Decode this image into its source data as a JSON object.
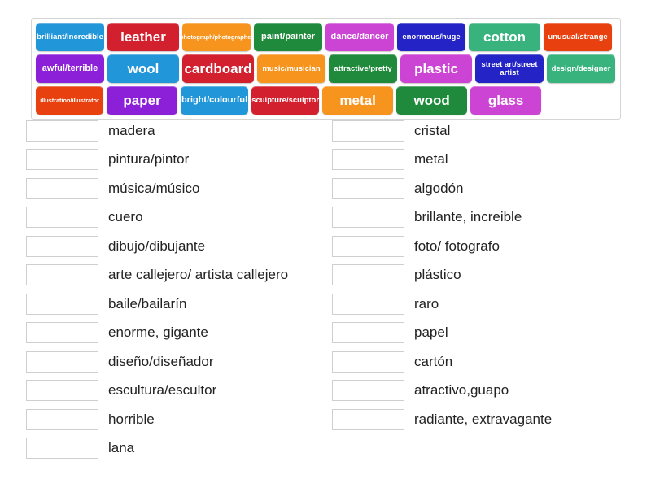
{
  "activity": {
    "type": "match-up",
    "tile_bank": {
      "rows": [
        [
          {
            "label": "brilliant/incredible",
            "color": "#2196d9",
            "size": "s"
          },
          {
            "label": "leather",
            "color": "#d3202f",
            "size": "xl"
          },
          {
            "label": "photograph/photographer",
            "color": "#f7941e",
            "size": "xs"
          },
          {
            "label": "paint/painter",
            "color": "#1f8a3b",
            "size": "m"
          },
          {
            "label": "dance/dancer",
            "color": "#cc44d4",
            "size": "m"
          },
          {
            "label": "enormous/huge",
            "color": "#2323c6",
            "size": "s"
          },
          {
            "label": "cotton",
            "color": "#39b37e",
            "size": "xl"
          },
          {
            "label": "unusual/strange",
            "color": "#e8400e",
            "size": "s"
          }
        ],
        [
          {
            "label": "awful/terrible",
            "color": "#8c1fd8",
            "size": "m"
          },
          {
            "label": "wool",
            "color": "#2196d9",
            "size": "xl"
          },
          {
            "label": "cardboard",
            "color": "#d3202f",
            "size": "xl"
          },
          {
            "label": "music/musician",
            "color": "#f7941e",
            "size": "s"
          },
          {
            "label": "attractive/pretty",
            "color": "#1f8a3b",
            "size": "s"
          },
          {
            "label": "plastic",
            "color": "#cc44d4",
            "size": "xl"
          },
          {
            "label": "street art/street artist",
            "color": "#2323c6",
            "size": "s"
          },
          {
            "label": "design/designer",
            "color": "#39b37e",
            "size": "s"
          }
        ],
        [
          {
            "label": "illustration/illustrator",
            "color": "#e8400e",
            "size": "xs"
          },
          {
            "label": "paper",
            "color": "#8c1fd8",
            "size": "xl"
          },
          {
            "label": "bright/colourful",
            "color": "#2196d9",
            "size": "m"
          },
          {
            "label": "sculpture/sculptor",
            "color": "#d3202f",
            "size": "s"
          },
          {
            "label": "metal",
            "color": "#f7941e",
            "size": "xl"
          },
          {
            "label": "wood",
            "color": "#1f8a3b",
            "size": "xl"
          },
          {
            "label": "glass",
            "color": "#cc44d4",
            "size": "xl"
          },
          {
            "label": "",
            "color": "",
            "size": "empty"
          }
        ]
      ]
    },
    "answers": {
      "left_column": [
        {
          "text": "madera",
          "slot_value": ""
        },
        {
          "text": "pintura/pintor",
          "slot_value": ""
        },
        {
          "text": "música/músico",
          "slot_value": ""
        },
        {
          "text": "cuero",
          "slot_value": ""
        },
        {
          "text": "dibujo/dibujante",
          "slot_value": ""
        },
        {
          "text": "arte callejero/ artista callejero",
          "slot_value": ""
        },
        {
          "text": "baile/bailarín",
          "slot_value": ""
        },
        {
          "text": "enorme, gigante",
          "slot_value": ""
        },
        {
          "text": "diseño/diseñador",
          "slot_value": ""
        },
        {
          "text": "escultura/escultor",
          "slot_value": ""
        },
        {
          "text": "horrible",
          "slot_value": ""
        },
        {
          "text": "lana",
          "slot_value": ""
        }
      ],
      "right_column": [
        {
          "text": "cristal",
          "slot_value": ""
        },
        {
          "text": "metal",
          "slot_value": ""
        },
        {
          "text": "algodón",
          "slot_value": ""
        },
        {
          "text": "brillante, increible",
          "slot_value": ""
        },
        {
          "text": "foto/ fotografo",
          "slot_value": ""
        },
        {
          "text": "plástico",
          "slot_value": ""
        },
        {
          "text": "raro",
          "slot_value": ""
        },
        {
          "text": "papel",
          "slot_value": ""
        },
        {
          "text": "cartón",
          "slot_value": ""
        },
        {
          "text": "atractivo,guapo",
          "slot_value": ""
        },
        {
          "text": "radiante, extravagante",
          "slot_value": ""
        }
      ]
    }
  }
}
